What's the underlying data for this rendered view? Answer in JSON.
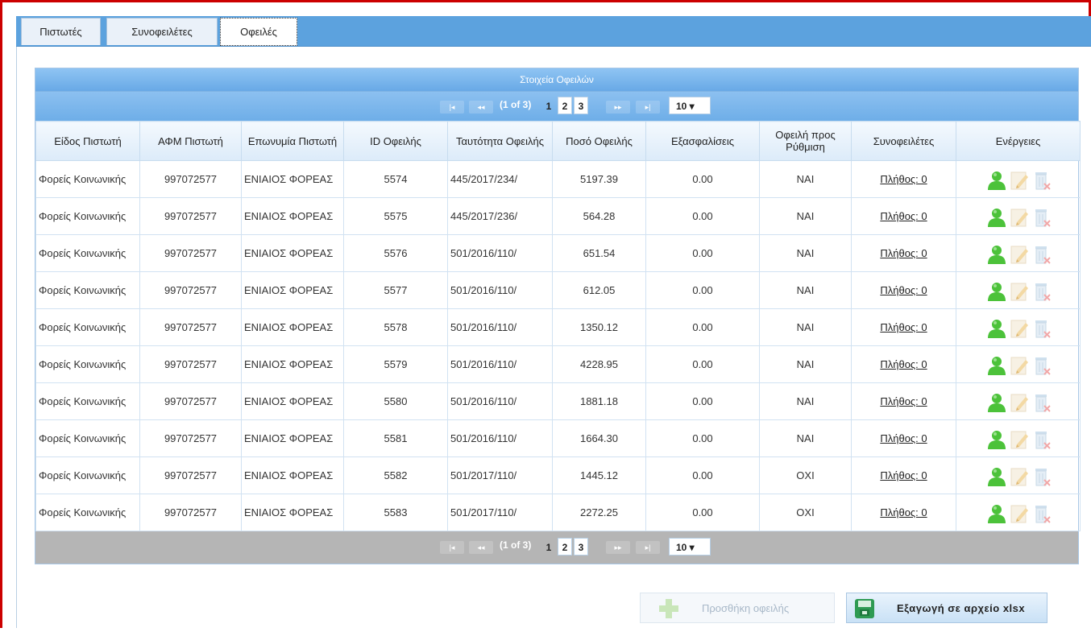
{
  "tabs": [
    "Πιστωτές",
    "Συνοφειλέτες",
    "Οφειλές"
  ],
  "grid": {
    "caption": "Στοιχεία Οφειλών",
    "pager": {
      "info": "(1 of 3)",
      "first": "|◂",
      "prev": "◂◂",
      "pages": [
        "1",
        "2",
        "3"
      ],
      "next": "▸▸",
      "last": "▸|",
      "rows_per_page": "10 ▾"
    },
    "columns": [
      "Είδος Πιστωτή",
      "ΑΦΜ Πιστωτή",
      "Επωνυμία Πιστωτή",
      "ID Οφειλής",
      "Ταυτότητα Οφειλής",
      "Ποσό Οφειλής",
      "Εξασφαλίσεις",
      "Οφειλή προς Ρύθμιση",
      "Συνοφειλέτες",
      "Ενέργειες"
    ],
    "rows": [
      [
        "Φορείς Κοινωνικής",
        "997072577",
        "ΕΝΙΑΙΟΣ ΦΟΡΕΑΣ",
        "5574",
        "445/2017/234/",
        "5197.39",
        "0.00",
        "ΝΑΙ",
        "Πλήθος: 0"
      ],
      [
        "Φορείς Κοινωνικής",
        "997072577",
        "ΕΝΙΑΙΟΣ ΦΟΡΕΑΣ",
        "5575",
        "445/2017/236/",
        "564.28",
        "0.00",
        "ΝΑΙ",
        "Πλήθος: 0"
      ],
      [
        "Φορείς Κοινωνικής",
        "997072577",
        "ΕΝΙΑΙΟΣ ΦΟΡΕΑΣ",
        "5576",
        "501/2016/110/",
        "651.54",
        "0.00",
        "ΝΑΙ",
        "Πλήθος: 0"
      ],
      [
        "Φορείς Κοινωνικής",
        "997072577",
        "ΕΝΙΑΙΟΣ ΦΟΡΕΑΣ",
        "5577",
        "501/2016/110/",
        "612.05",
        "0.00",
        "ΝΑΙ",
        "Πλήθος: 0"
      ],
      [
        "Φορείς Κοινωνικής",
        "997072577",
        "ΕΝΙΑΙΟΣ ΦΟΡΕΑΣ",
        "5578",
        "501/2016/110/",
        "1350.12",
        "0.00",
        "ΝΑΙ",
        "Πλήθος: 0"
      ],
      [
        "Φορείς Κοινωνικής",
        "997072577",
        "ΕΝΙΑΙΟΣ ΦΟΡΕΑΣ",
        "5579",
        "501/2016/110/",
        "4228.95",
        "0.00",
        "ΝΑΙ",
        "Πλήθος: 0"
      ],
      [
        "Φορείς Κοινωνικής",
        "997072577",
        "ΕΝΙΑΙΟΣ ΦΟΡΕΑΣ",
        "5580",
        "501/2016/110/",
        "1881.18",
        "0.00",
        "ΝΑΙ",
        "Πλήθος: 0"
      ],
      [
        "Φορείς Κοινωνικής",
        "997072577",
        "ΕΝΙΑΙΟΣ ΦΟΡΕΑΣ",
        "5581",
        "501/2016/110/",
        "1664.30",
        "0.00",
        "ΝΑΙ",
        "Πλήθος: 0"
      ],
      [
        "Φορείς Κοινωνικής",
        "997072577",
        "ΕΝΙΑΙΟΣ ΦΟΡΕΑΣ",
        "5582",
        "501/2017/110/",
        "1445.12",
        "0.00",
        "ΟΧΙ",
        "Πλήθος: 0"
      ],
      [
        "Φορείς Κοινωνικής",
        "997072577",
        "ΕΝΙΑΙΟΣ ΦΟΡΕΑΣ",
        "5583",
        "501/2017/110/",
        "2272.25",
        "0.00",
        "ΟΧΙ",
        "Πλήθος: 0"
      ]
    ],
    "row_actions": [
      "user-icon",
      "edit-icon",
      "delete-icon"
    ]
  },
  "buttons": {
    "add": "Προσθήκη οφειλής",
    "export": "Εξαγωγή σε αρχείο xlsx"
  },
  "colors": {
    "tabbar": "#5ca2de",
    "grid_header": "#68a9e6",
    "bottom_pager": "#b5b5b5",
    "frame_border": "#cc0000",
    "action_green": "#4cc23a"
  }
}
